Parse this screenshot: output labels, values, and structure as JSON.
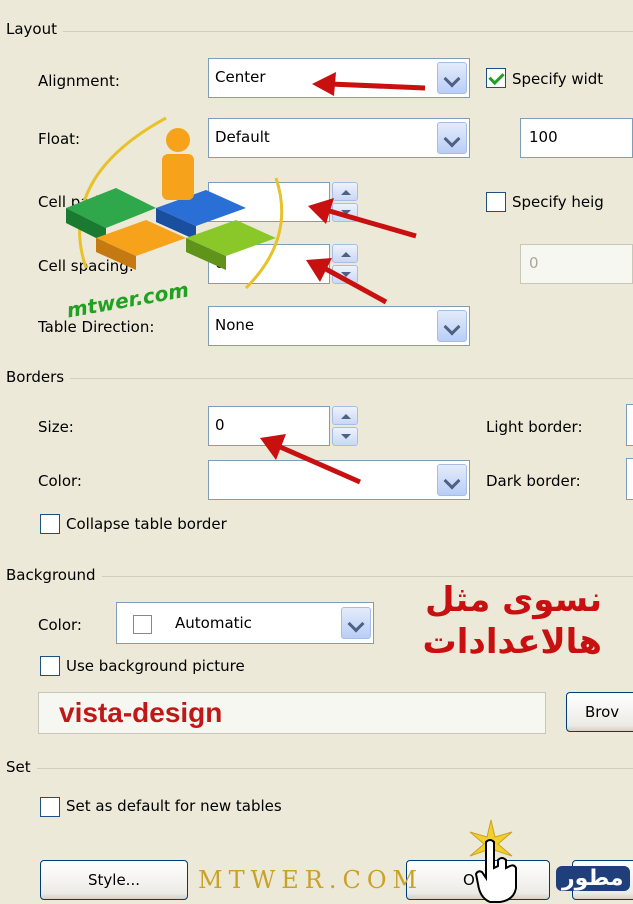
{
  "layout": {
    "group_label": "Layout",
    "alignment": {
      "label": "Alignment:",
      "value": "Center"
    },
    "float": {
      "label": "Float:",
      "value": "Default"
    },
    "cell_padding": {
      "label": "Cell padding:",
      "value": ""
    },
    "cell_spacing": {
      "label": "Cell spacing:",
      "value": "0"
    },
    "table_direction": {
      "label": "Table Direction:",
      "value": "None"
    },
    "specify_width": {
      "label": "Specify widt",
      "checked": true,
      "value": "100"
    },
    "specify_height": {
      "label": "Specify heig",
      "checked": false,
      "value": "0"
    }
  },
  "borders": {
    "group_label": "Borders",
    "size": {
      "label": "Size:",
      "value": "0"
    },
    "color": {
      "label": "Color:",
      "value": ""
    },
    "light_border": {
      "label": "Light border:"
    },
    "dark_border": {
      "label": "Dark border:"
    },
    "collapse": {
      "label": "Collapse table border",
      "checked": false
    }
  },
  "background": {
    "group_label": "Background",
    "color": {
      "label": "Color:",
      "value": "Automatic"
    },
    "use_picture": {
      "label": "Use background picture",
      "checked": false
    },
    "picture_path": "vista-design",
    "browse_label": "Brov"
  },
  "set": {
    "group_label": "Set",
    "default": {
      "label": "Set as default for new tables",
      "checked": false
    }
  },
  "buttons": {
    "style": "Style...",
    "ok": "O"
  },
  "overlay": {
    "arabic_line1": "نسوى مثل",
    "arabic_line2": "هالاعدادات",
    "watermark_bottom": "MTWER.COM",
    "watermark_side": "mtwer.com",
    "logo_text": "مطور"
  },
  "colors": {
    "dialog_bg": "#ece9d8",
    "annotation_red": "#c81010",
    "watermark_gold": "#c9a227"
  }
}
